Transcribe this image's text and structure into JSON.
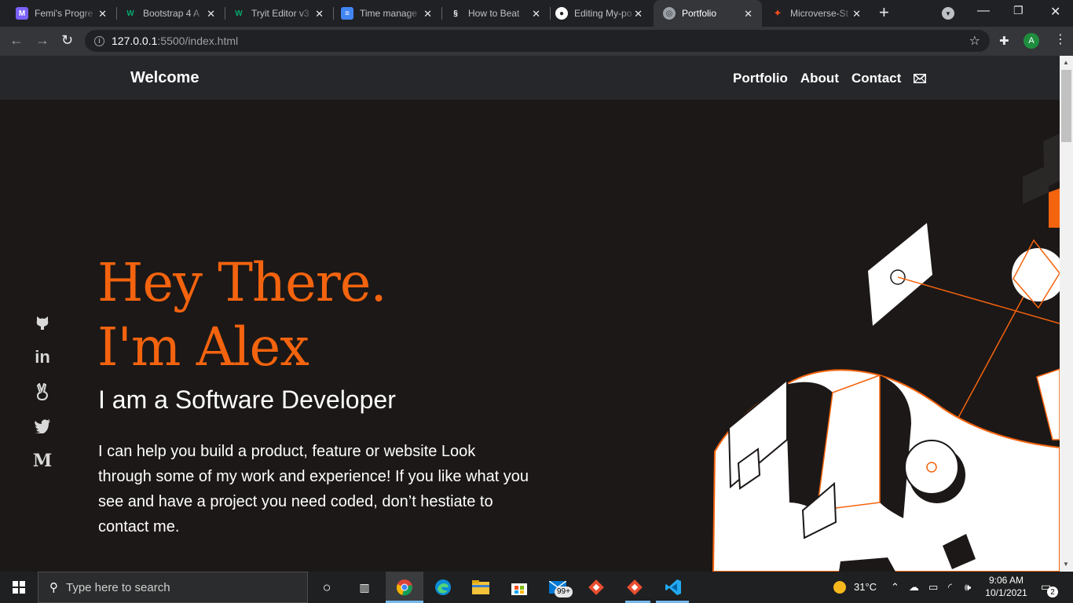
{
  "browser": {
    "tabs": [
      {
        "title": "Femi's Progre",
        "favicon": "purple-m-icon",
        "color": "#7b61ff"
      },
      {
        "title": "Bootstrap 4 A",
        "favicon": "w3schools-icon",
        "color": "#04aa6d"
      },
      {
        "title": "Tryit Editor v3",
        "favicon": "w3schools-icon",
        "color": "#04aa6d"
      },
      {
        "title": "Time manage",
        "favicon": "google-docs-icon",
        "color": "#4285f4"
      },
      {
        "title": "How to Beat",
        "favicon": "squarespace-icon",
        "color": "#ffffff"
      },
      {
        "title": "Editing My-po",
        "favicon": "github-icon",
        "color": "#ffffff"
      },
      {
        "title": "Portfolio",
        "favicon": "globe-icon",
        "color": "#9aa0a6",
        "active": true
      },
      {
        "title": "Microverse-St",
        "favicon": "figma-icon",
        "color": "#f24e1e"
      }
    ],
    "url_host": "127.0.0.1",
    "url_path": ":5500/index.html",
    "profile_initial": "A"
  },
  "site": {
    "brand": "Welcome",
    "nav": [
      "Portfolio",
      "About",
      "Contact"
    ],
    "hero_line1": "Hey There.",
    "hero_line2": "I'm Alex",
    "subtitle": "I am a Software Developer",
    "intro": "I can help you build a product, feature or website Look through some of my work and experience! If you like what you see and have a project you need coded, don’t hestiate to contact me.",
    "social": [
      "github-icon",
      "linkedin-icon",
      "angellist-icon",
      "twitter-icon",
      "medium-icon"
    ],
    "accent_color": "#f4630e"
  },
  "taskbar": {
    "search_placeholder": "Type here to search",
    "mail_badge": "99+",
    "weather": "31°C",
    "time": "9:06 AM",
    "date": "10/1/2021",
    "notification_count": "2"
  }
}
